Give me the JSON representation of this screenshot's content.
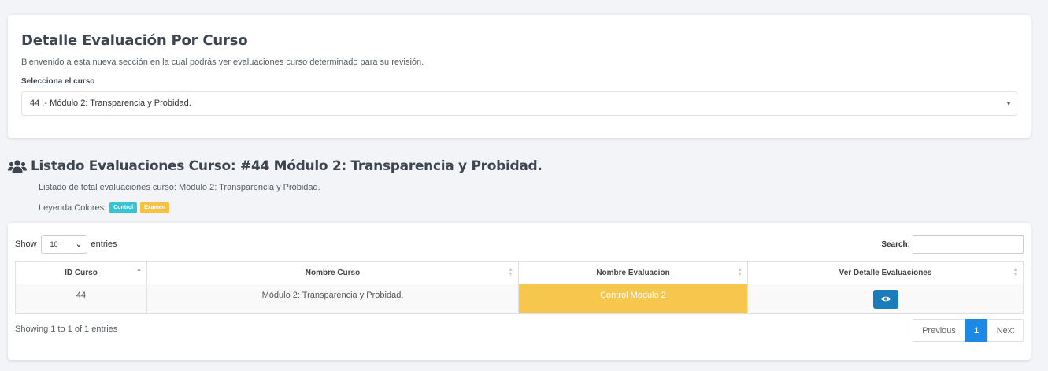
{
  "header_card": {
    "title": "Detalle Evaluación Por Curso",
    "subtitle": "Bienvenido a esta nueva sección en la cual podrás ver evaluaciones curso determinado para su revisión.",
    "select_label": "Selecciona el curso",
    "select_value": "44 .- Módulo 2: Transparencia y Probidad."
  },
  "list_section": {
    "icon": "users-icon",
    "title": "Listado Evaluaciones Curso: #44 Módulo 2: Transparencia y Probidad.",
    "description": "Listado de total evaluaciones curso: Módulo 2: Transparencia y Probidad.",
    "legend_label": "Leyenda Colores:",
    "legend": [
      {
        "label": "Control",
        "color": "#36c6d3"
      },
      {
        "label": "Examen",
        "color": "#f5c242"
      }
    ]
  },
  "table_controls": {
    "show_label": "Show",
    "entries_value": "10",
    "entries_label": "entries",
    "search_label": "Search:",
    "search_placeholder": ""
  },
  "table": {
    "columns": [
      "ID Curso",
      "Nombre Curso",
      "Nombre Evaluacion",
      "Ver Detalle Evaluaciones"
    ],
    "rows": [
      {
        "id": "44",
        "course": "Módulo 2: Transparencia y Probidad.",
        "evaluation": "Control Modulo 2",
        "action_icon": "eye-icon"
      }
    ]
  },
  "footer": {
    "info": "Showing 1 to 1 of 1 entries",
    "previous": "Previous",
    "current_page": "1",
    "next": "Next"
  },
  "colors": {
    "accent": "#1a7cb8",
    "page_active": "#1e88e5",
    "examen_row": "#f7c64c"
  }
}
